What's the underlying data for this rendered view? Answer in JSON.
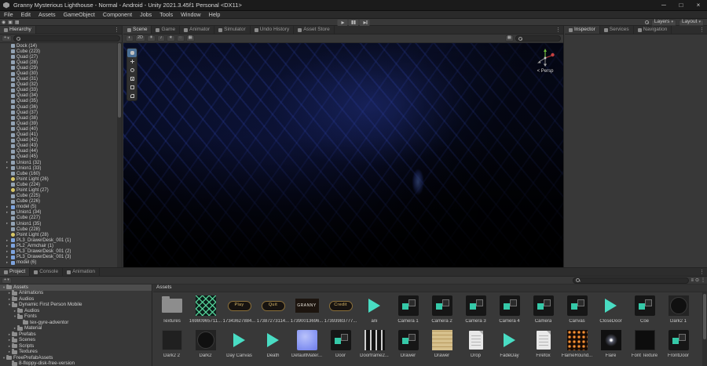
{
  "icons": {
    "plus": "+",
    "caret": "▾",
    "menu": "⋮",
    "arrow_open": "▾",
    "arrow_closed": "▸",
    "draw_mode": "◐",
    "two_d": "2D",
    "lighting": "☀",
    "audio": "♪",
    "effects": "∗",
    "hidden": "◌",
    "grid": "▦",
    "gizmos": "▦",
    "account": "◉",
    "cloud": "▣",
    "columns": "≡",
    "lock": "⊙"
  },
  "title_bar": {
    "title": "Granny Mysterious Lighthouse - Normal - Android - Unity 2021.3.45f1 Personal <DX11>",
    "window_controls": {
      "minimize": "─",
      "maximize": "□",
      "close": "×"
    }
  },
  "menu_bar": {
    "items": [
      "File",
      "Edit",
      "Assets",
      "GameObject",
      "Component",
      "Jobs",
      "Tools",
      "Window",
      "Help"
    ]
  },
  "toolbar": {
    "layers_label": "Layers",
    "layout_label": "Layout"
  },
  "hierarchy": {
    "tab_label": "Hierarchy",
    "items": [
      {
        "label": "Dock (14)",
        "icon": "cube"
      },
      {
        "label": "Cube (223)",
        "icon": "cube"
      },
      {
        "label": "Quad (27)",
        "icon": "cube"
      },
      {
        "label": "Quad (28)",
        "icon": "cube"
      },
      {
        "label": "Quad (29)",
        "icon": "cube"
      },
      {
        "label": "Quad (30)",
        "icon": "cube"
      },
      {
        "label": "Quad (31)",
        "icon": "cube"
      },
      {
        "label": "Quad (32)",
        "icon": "cube"
      },
      {
        "label": "Quad (33)",
        "icon": "cube"
      },
      {
        "label": "Quad (34)",
        "icon": "cube"
      },
      {
        "label": "Quad (35)",
        "icon": "cube"
      },
      {
        "label": "Quad (36)",
        "icon": "cube"
      },
      {
        "label": "Quad (37)",
        "icon": "cube"
      },
      {
        "label": "Quad (38)",
        "icon": "cube"
      },
      {
        "label": "Quad (39)",
        "icon": "cube"
      },
      {
        "label": "Quad (40)",
        "icon": "cube"
      },
      {
        "label": "Quad (41)",
        "icon": "cube"
      },
      {
        "label": "Quad (42)",
        "icon": "cube"
      },
      {
        "label": "Quad (43)",
        "icon": "cube"
      },
      {
        "label": "Quad (44)",
        "icon": "cube"
      },
      {
        "label": "Quad (45)",
        "icon": "cube"
      },
      {
        "label": "Union1 (32)",
        "icon": "cube",
        "arrow": true
      },
      {
        "label": "Union1 (33)",
        "icon": "cube",
        "arrow": true
      },
      {
        "label": "Cube (160)",
        "icon": "cube"
      },
      {
        "label": "Point Light (26)",
        "icon": "light"
      },
      {
        "label": "Cube (224)",
        "icon": "cube"
      },
      {
        "label": "Point Light (27)",
        "icon": "light"
      },
      {
        "label": "Cube (225)",
        "icon": "cube"
      },
      {
        "label": "Cube (226)",
        "icon": "cube"
      },
      {
        "label": "model (5)",
        "icon": "prefab",
        "arrow": true
      },
      {
        "label": "Union1 (34)",
        "icon": "cube",
        "arrow": true
      },
      {
        "label": "Cube (227)",
        "icon": "cube"
      },
      {
        "label": "Union1 (35)",
        "icon": "cube",
        "arrow": true
      },
      {
        "label": "Cube (228)",
        "icon": "cube"
      },
      {
        "label": "Point Light (28)",
        "icon": "light"
      },
      {
        "label": "PL3_DrawerDesk_001 (1)",
        "icon": "prefab",
        "arrow": true
      },
      {
        "label": "PL2_Armchair (1)",
        "icon": "prefab",
        "arrow": true
      },
      {
        "label": "PL3_DrawerDesk_001 (2)",
        "icon": "prefab",
        "arrow": true
      },
      {
        "label": "PL3_DrawerDesk_001 (3)",
        "icon": "prefab",
        "arrow": true
      },
      {
        "label": "model (6)",
        "icon": "prefab",
        "arrow": true
      }
    ]
  },
  "scene_panel": {
    "tabs": [
      {
        "label": "Scene",
        "active": true
      },
      {
        "label": "Game"
      },
      {
        "label": "Animator"
      },
      {
        "label": "Simulator"
      },
      {
        "label": "Undo History"
      },
      {
        "label": "Asset Store"
      }
    ],
    "toolbar_left": [
      "draw_mode",
      "two_d",
      "lighting",
      "audio",
      "effects",
      "hidden",
      "grid"
    ],
    "toolbar_right": [
      "gizmos"
    ],
    "gizmo_label": "< Persp"
  },
  "inspector": {
    "tabs": [
      {
        "label": "Inspector",
        "active": true
      },
      {
        "label": "Services"
      },
      {
        "label": "Navigation"
      }
    ]
  },
  "bottom_panel": {
    "tabs": [
      {
        "label": "Project",
        "active": true
      },
      {
        "label": "Console"
      },
      {
        "label": "Animation"
      }
    ],
    "breadcrumb": "Assets",
    "tree": [
      {
        "label": "Assets",
        "level": 0,
        "arrow": "open",
        "selected": true
      },
      {
        "label": "Animations",
        "level": 1,
        "arrow": "closed"
      },
      {
        "label": "Audios",
        "level": 1,
        "arrow": "closed"
      },
      {
        "label": "Dynamic First Person Mobile",
        "level": 1,
        "arrow": "open"
      },
      {
        "label": "Audios",
        "level": 2,
        "arrow": "closed"
      },
      {
        "label": "Fonts",
        "level": 2,
        "arrow": "open"
      },
      {
        "label": "tex-gyre-adventor",
        "level": 3,
        "arrow": "none"
      },
      {
        "label": "Material",
        "level": 2,
        "arrow": "closed"
      },
      {
        "label": "Prefabs",
        "level": 1,
        "arrow": "closed"
      },
      {
        "label": "Scenes",
        "level": 1,
        "arrow": "closed"
      },
      {
        "label": "Scripts",
        "level": 1,
        "arrow": "closed"
      },
      {
        "label": "Textures",
        "level": 1,
        "arrow": "closed"
      },
      {
        "label": "FreePrefabAssets",
        "level": 0,
        "arrow": "open"
      },
      {
        "label": "8-floppy-disk-free-version",
        "level": 1,
        "arrow": "none"
      }
    ],
    "assets": [
      {
        "label": "Textures",
        "kind": "folder"
      },
      {
        "label": "16980965711...",
        "kind": "grid"
      },
      {
        "label": "17343627884...",
        "kind": "button",
        "text": "Play"
      },
      {
        "label": "17387273114...",
        "kind": "button",
        "text": "Quit"
      },
      {
        "label": "17390013696...",
        "kind": "granny",
        "text": "GRANNY"
      },
      {
        "label": "17393983777...",
        "kind": "button",
        "text": "Credit"
      },
      {
        "label": "ani",
        "kind": "anim"
      },
      {
        "label": "Camera 1",
        "kind": "prefab"
      },
      {
        "label": "Camera 2",
        "kind": "prefab"
      },
      {
        "label": "Camera 3",
        "kind": "prefab"
      },
      {
        "label": "Camera 4",
        "kind": "prefab"
      },
      {
        "label": "Camera",
        "kind": "prefab"
      },
      {
        "label": "Canvas",
        "kind": "prefab"
      },
      {
        "label": "CloseDoor",
        "kind": "anim"
      },
      {
        "label": "Coe",
        "kind": "prefab"
      },
      {
        "label": "Dark2 1",
        "kind": "circle"
      },
      {
        "label": "Dark2 2",
        "kind": "square"
      },
      {
        "label": "Dark2",
        "kind": "circle"
      },
      {
        "label": "Day Canvas",
        "kind": "anim"
      },
      {
        "label": "Death",
        "kind": "anim"
      },
      {
        "label": "DefaultMater...",
        "kind": "material"
      },
      {
        "label": "Door",
        "kind": "prefab"
      },
      {
        "label": "Doorframe2...",
        "kind": "stripes"
      },
      {
        "label": "Drawer",
        "kind": "prefab"
      },
      {
        "label": "Drawer",
        "kind": "wood"
      },
      {
        "label": "Drop",
        "kind": "doc"
      },
      {
        "label": "FadeDay",
        "kind": "anim"
      },
      {
        "label": "Firefox",
        "kind": "doc"
      },
      {
        "label": "FlameRound...",
        "kind": "flame"
      },
      {
        "label": "Flare",
        "kind": "flare"
      },
      {
        "label": "Font Texture",
        "kind": "darktex"
      },
      {
        "label": "FrontDoor",
        "kind": "prefab"
      }
    ]
  }
}
